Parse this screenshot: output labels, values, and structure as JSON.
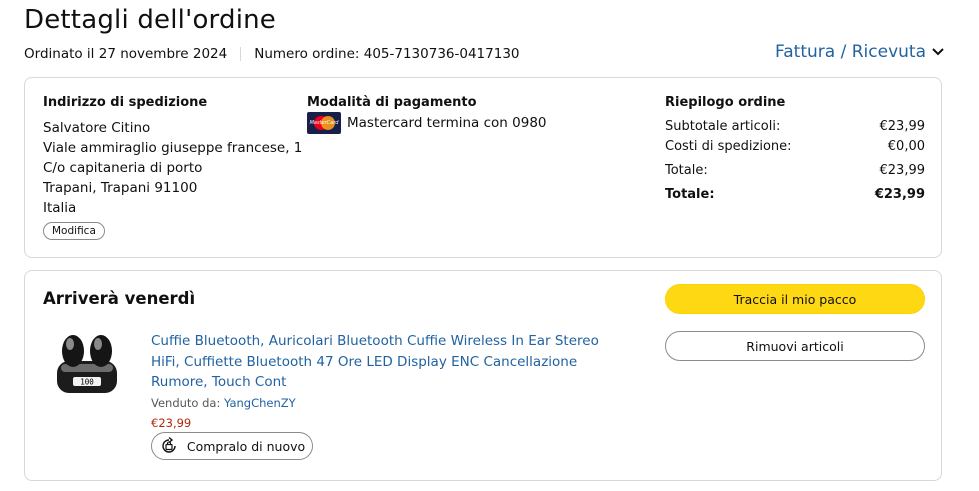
{
  "header": {
    "title": "Dettagli dell'ordine",
    "ordered_on": "Ordinato il 27 novembre 2024",
    "order_number": "Numero ordine: 405-7130736-0417130",
    "invoice_label": "Fattura / Ricevuta"
  },
  "shipping": {
    "heading": "Indirizzo di spedizione",
    "lines": [
      "Salvatore Citino",
      "Viale ammiraglio giuseppe francese, 1",
      "C/o capitaneria di porto",
      "Trapani, Trapani 91100",
      "Italia"
    ],
    "edit_label": "Modifica"
  },
  "payment": {
    "heading": "Modalità di pagamento",
    "card_text": "Mastercard termina con 0980",
    "card_logo_text": "MasterCard"
  },
  "summary": {
    "heading": "Riepilogo ordine",
    "rows": [
      {
        "label": "Subtotale articoli:",
        "value": "€23,99"
      },
      {
        "label": "Costi di spedizione:",
        "value": "€0,00"
      },
      {
        "label": "Totale:",
        "value": "€23,99"
      },
      {
        "label": "Totale:",
        "value": "€23,99"
      }
    ]
  },
  "delivery": {
    "heading": "Arriverà venerdì",
    "product_title": "Cuffie Bluetooth, Auricolari Bluetooth Cuffie Wireless In Ear Stereo HiFi, Cuffiette Bluetooth 47 Ore LED Display ENC Cancellazione Rumore, Touch Cont",
    "sold_by_label": "Venduto da:",
    "seller": "YangChenZY",
    "price": "€23,99",
    "buy_again_label": "Compralo di nuovo",
    "product_image_display": "100",
    "track_label": "Traccia il mio pacco",
    "remove_label": "Rimuovi articoli"
  },
  "colors": {
    "link": "#2162a1",
    "price": "#b12704",
    "primary_button": "#ffd814",
    "border": "#d5d9d9"
  }
}
